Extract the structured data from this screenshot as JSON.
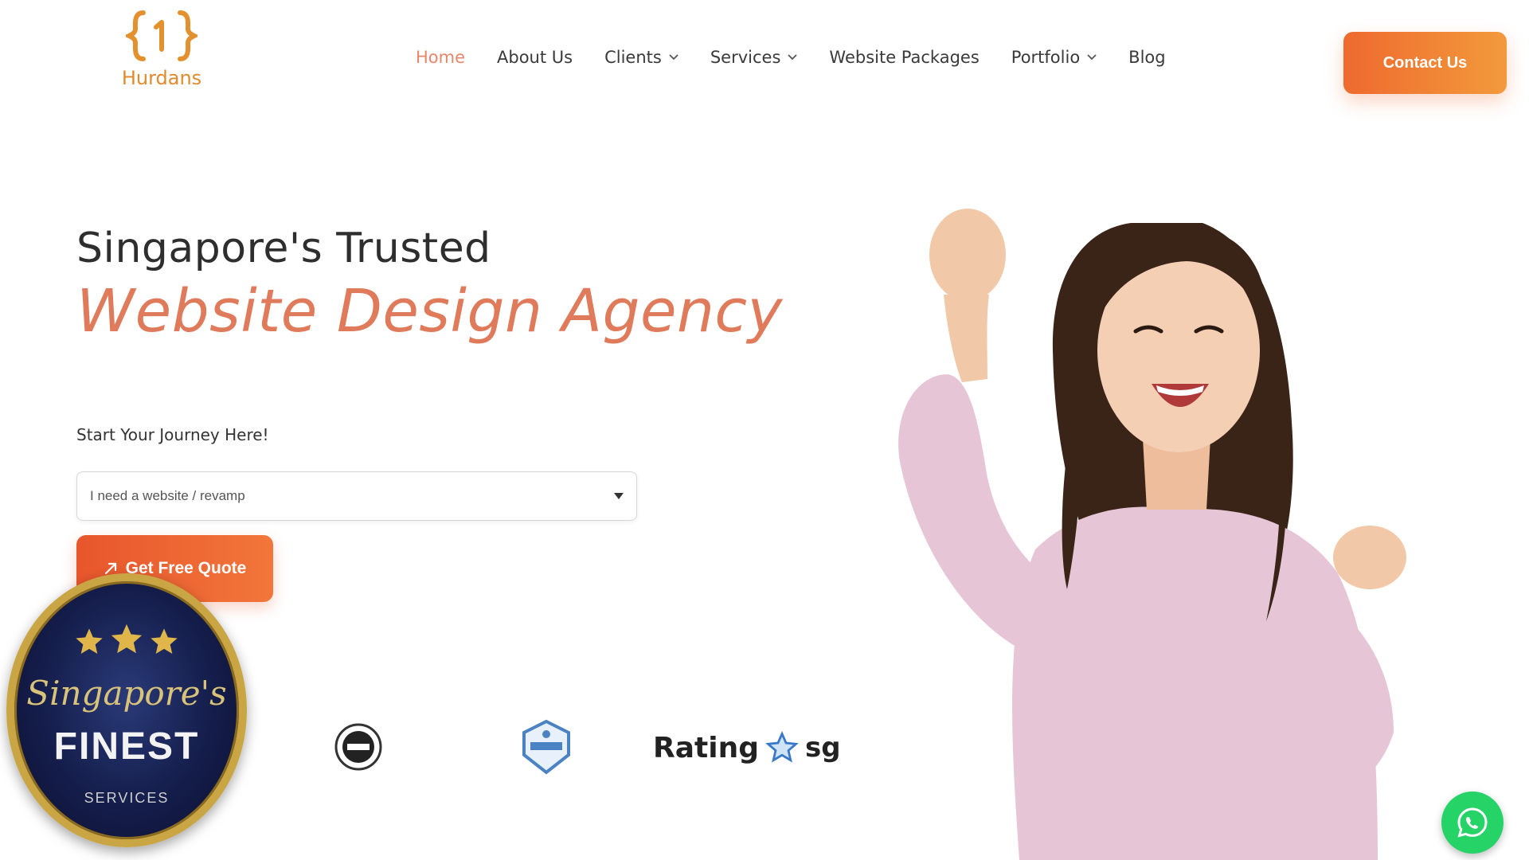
{
  "brand": {
    "name": "Hurdans",
    "accent": "#e8866a",
    "orange": "#ee6a2e"
  },
  "nav": {
    "items": [
      {
        "label": "Home",
        "active": true,
        "has_dropdown": false
      },
      {
        "label": "About Us",
        "active": false,
        "has_dropdown": false
      },
      {
        "label": "Clients",
        "active": false,
        "has_dropdown": true
      },
      {
        "label": "Services",
        "active": false,
        "has_dropdown": true
      },
      {
        "label": "Website Packages",
        "active": false,
        "has_dropdown": false
      },
      {
        "label": "Portfolio",
        "active": false,
        "has_dropdown": true
      },
      {
        "label": "Blog",
        "active": false,
        "has_dropdown": false
      }
    ],
    "contact_label": "Contact Us"
  },
  "hero": {
    "subtitle": "Singapore's Trusted",
    "title": "Website Design Agency",
    "journey_label": "Start Your Journey Here!",
    "select_value": "I need a website / revamp",
    "quote_label": "Get Free Quote"
  },
  "badge": {
    "script": "Singapore's",
    "title": "FINEST",
    "subtitle": "SERVICES"
  },
  "trust": {
    "rating_label": "Rating",
    "rating_suffix": "sg"
  }
}
